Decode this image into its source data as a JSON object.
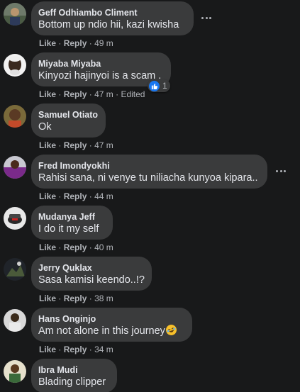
{
  "colors": {
    "background": "#18191a",
    "bubble": "#3a3b3c",
    "primary_text": "#e4e6eb",
    "secondary_text": "#b0b3b8",
    "like_blue": "#1877f2"
  },
  "labels": {
    "like": "Like",
    "reply": "Reply",
    "separator": "·"
  },
  "comments": [
    {
      "author": "Geff Odhiambo Climent",
      "text": "Bottom up ndio hii, kazi kwisha",
      "time": "49 m"
    },
    {
      "author": "Miyaba Miyaba",
      "text": "Kinyozi hajinyoi is a scam .",
      "time": "47 m",
      "edited": "Edited",
      "reaction": {
        "icon": "like-reaction-icon",
        "count": "1"
      }
    },
    {
      "author": "Samuel Otiato",
      "text": "Ok",
      "time": "47 m"
    },
    {
      "author": "Fred Imondyokhi",
      "text": "Rahisi sana, ni venye tu niliacha kunyoa kipara..",
      "time": "44 m"
    },
    {
      "author": "Mudanya Jeff",
      "text": "I do it my self",
      "time": "40 m"
    },
    {
      "author": "Jerry Quklax",
      "text": "Sasa kamisi keendo..!?",
      "time": "38 m"
    },
    {
      "author": "Hans Onginjo",
      "text": "Am not alone in this journey",
      "time": "34 m",
      "emoji": "rofl-emoji-icon"
    },
    {
      "author": "Ibra Mudi",
      "text": "Blading clipper"
    }
  ]
}
